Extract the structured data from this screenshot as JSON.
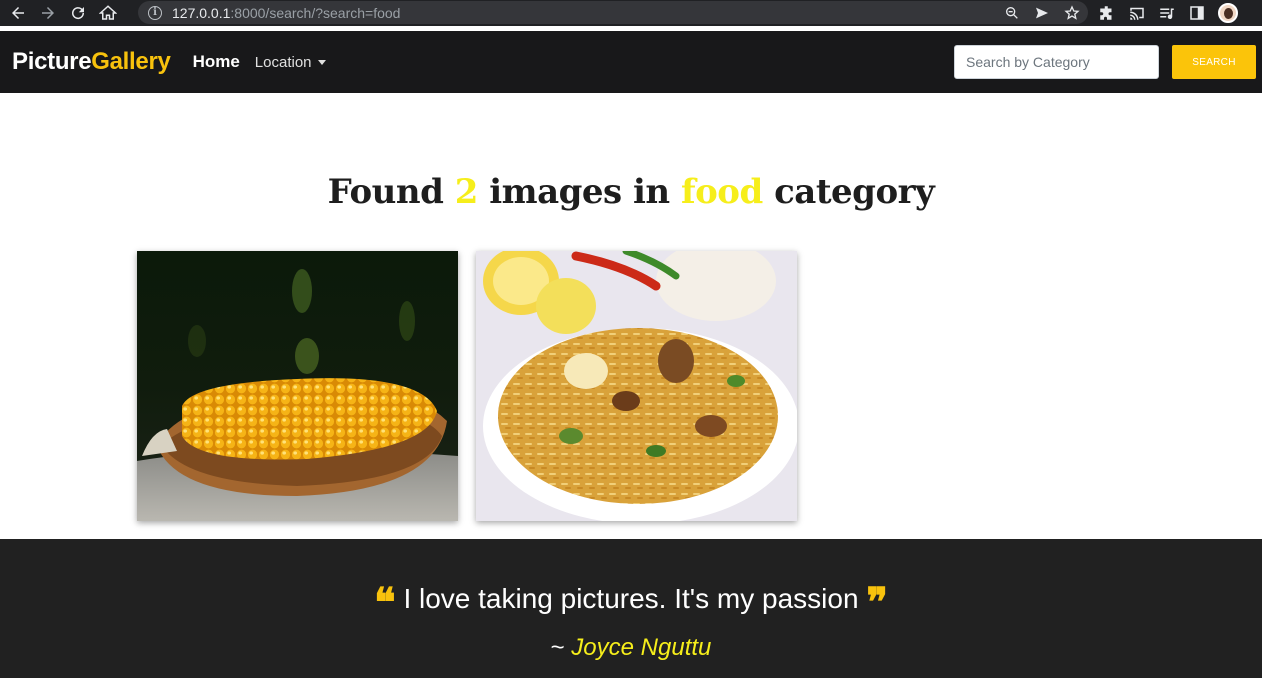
{
  "browser": {
    "url_host": "127.0.0.1",
    "url_rest": ":8000/search/?search=food"
  },
  "navbar": {
    "brand_primary": "Picture",
    "brand_accent": "Gallery",
    "home_label": "Home",
    "location_label": "Location",
    "search_placeholder": "Search by Category",
    "search_button_label": "SEARCH"
  },
  "results": {
    "prefix": "Found",
    "count": "2",
    "middle": "images in",
    "category": "food",
    "suffix": "category",
    "images": [
      {
        "subject": "corn"
      },
      {
        "subject": "biryani"
      }
    ]
  },
  "footer": {
    "quote": "I love taking pictures. It's my passion",
    "author_prefix": "~",
    "author_name": "Joyce Nguttu"
  },
  "colors": {
    "accent_yellow": "#f8c20d",
    "highlight_yellow": "#f6ee1b",
    "navbar_bg": "#18181a",
    "footer_bg": "#212121"
  }
}
